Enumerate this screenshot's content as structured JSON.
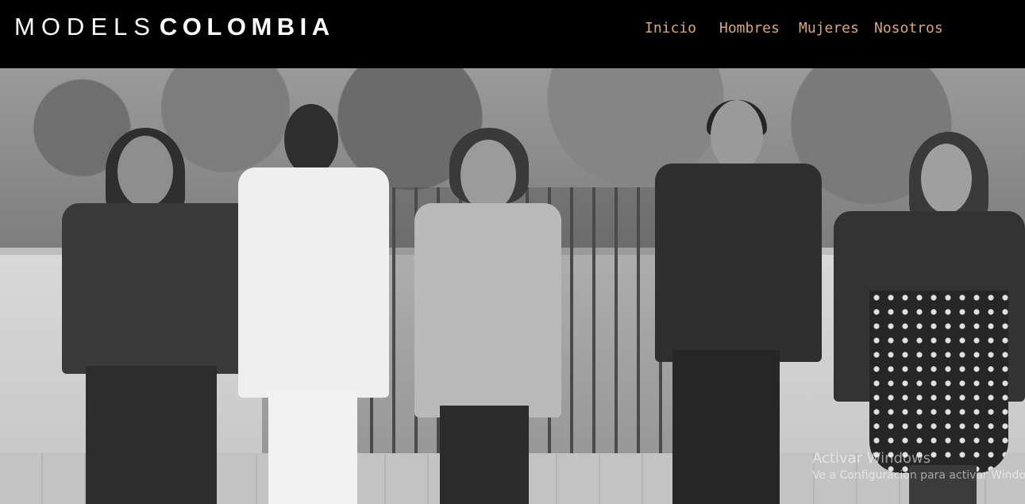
{
  "header": {
    "logo_light": "MODELS",
    "logo_bold": "COLOMBIA",
    "nav": [
      {
        "label": "Inicio"
      },
      {
        "label": "Hombres"
      },
      {
        "label": "Mujeres"
      },
      {
        "label": "Nosotros"
      }
    ]
  },
  "hero": {
    "photo_description": "Five fashion models posing outdoors in front of a white wall and trees (grayscale)"
  },
  "watermark": {
    "line1": "Activar Windows",
    "line2": "Ve a Configuración para activar Windows."
  },
  "colors": {
    "background": "#000000",
    "logo_text": "#ffffff",
    "nav_text": "#d9a77c"
  }
}
